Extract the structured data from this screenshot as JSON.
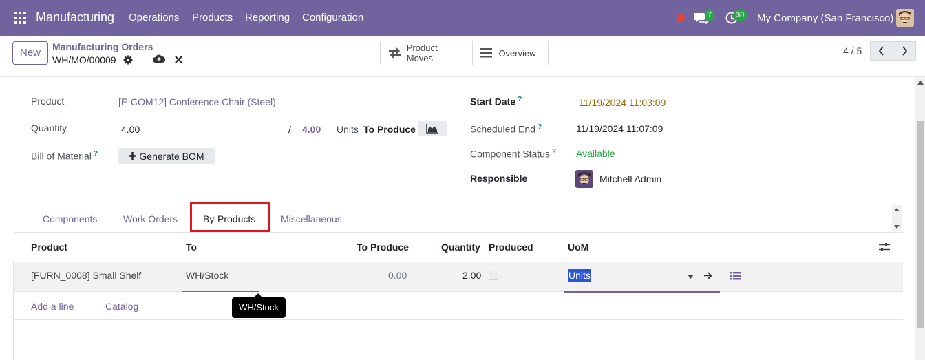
{
  "navbar": {
    "app_name": "Manufacturing",
    "menus": [
      "Operations",
      "Products",
      "Reporting",
      "Configuration"
    ],
    "messages_count": "7",
    "activities_count": "30",
    "company": "My Company (San Francisco)",
    "bg_color": "#71639e",
    "record_indicator_color": "#e0453a",
    "badge_color": "#28a745"
  },
  "control": {
    "new_label": "New",
    "breadcrumb_parent": "Manufacturing Orders",
    "breadcrumb_current": "WH/MO/00009",
    "smart_buttons": [
      {
        "label": "Product Moves",
        "icon": "arrows-exchange-icon"
      },
      {
        "label": "Overview",
        "icon": "list-bars-icon"
      }
    ],
    "pager": "4 / 5"
  },
  "form": {
    "product_label": "Product",
    "product_value": "[E-COM12] Conference Chair (Steel)",
    "quantity_label": "Quantity",
    "quantity_value": "4.00",
    "quantity_separator": "/",
    "quantity_total": "4.00",
    "units_label": "Units",
    "to_produce_label": "To Produce",
    "bom_label": "Bill of Material",
    "bom_help": "?",
    "generate_bom_label": "Generate BOM",
    "start_date_label": "Start Date",
    "start_date_value": "11/19/2024 11:03:09",
    "scheduled_end_label": "Scheduled End",
    "scheduled_end_value": "11/19/2024 11:07:09",
    "component_status_label": "Component Status",
    "component_status_value": "Available",
    "responsible_label": "Responsible",
    "responsible_value": "Mitchell Admin",
    "start_date_color": "#9a6a00",
    "available_color": "#28a745"
  },
  "tabs": [
    "Components",
    "Work Orders",
    "By-Products",
    "Miscellaneous"
  ],
  "active_tab": "By-Products",
  "table": {
    "headers": [
      "Product",
      "To",
      "To Produce",
      "Quantity",
      "Produced",
      "UoM"
    ],
    "row": {
      "product": "[FURN_0008] Small Shelf",
      "to": "WH/Stock",
      "to_produce": "0.00",
      "quantity": "2.00",
      "uom": "Units"
    },
    "add_line": "Add a line",
    "catalog": "Catalog",
    "tooltip": "WH/Stock"
  }
}
